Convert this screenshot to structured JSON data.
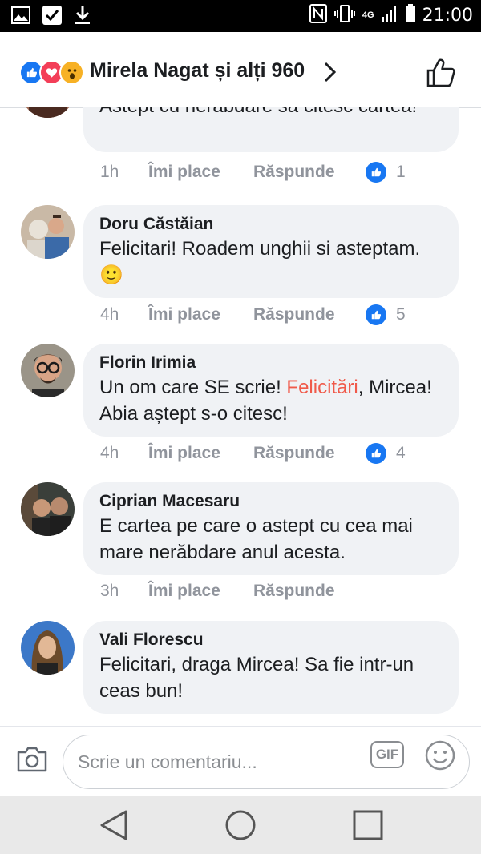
{
  "status_bar": {
    "time": "21:00",
    "network": "4G",
    "left_icons": [
      "image-icon",
      "checkbox-icon",
      "download-icon"
    ],
    "right_icons": [
      "nfc-icon",
      "vibrate-icon",
      "signal-icon",
      "battery-icon"
    ]
  },
  "header": {
    "title": "Mirela Nagat și alți 960",
    "reactions": [
      "like",
      "love",
      "wow"
    ]
  },
  "comments": [
    {
      "author": "",
      "text": "Astept cu nerabdare sa citesc cartea!",
      "time": "1h",
      "like_label": "Îmi place",
      "reply_label": "Răspunde",
      "likes": "1"
    },
    {
      "author": "Doru Căstăian",
      "text": "Felicitari! Roadem unghii si asteptam.",
      "emoji": "🙂",
      "time": "4h",
      "like_label": "Îmi place",
      "reply_label": "Răspunde",
      "likes": "5"
    },
    {
      "author": "Florin Irimia",
      "text_before": "Un om care SE scrie! ",
      "text_highlight": "Felicitări",
      "text_after": ", Mircea! Abia aștept s-o citesc!",
      "time": "4h",
      "like_label": "Îmi place",
      "reply_label": "Răspunde",
      "likes": "4"
    },
    {
      "author": "Ciprian Macesaru",
      "text": "E cartea pe care o astept cu cea mai mare nerăbdare anul acesta.",
      "time": "3h",
      "like_label": "Îmi place",
      "reply_label": "Răspunde"
    },
    {
      "author": "Vali Florescu",
      "text": "Felicitari, draga Mircea! Sa fie intr-un ceas bun!"
    }
  ],
  "composer": {
    "placeholder": "Scrie un comentariu...",
    "gif_label": "GIF"
  },
  "colors": {
    "accent": "#1877f2",
    "highlight": "#f05a4a",
    "bubble": "#f0f2f5",
    "meta": "#90949c"
  }
}
